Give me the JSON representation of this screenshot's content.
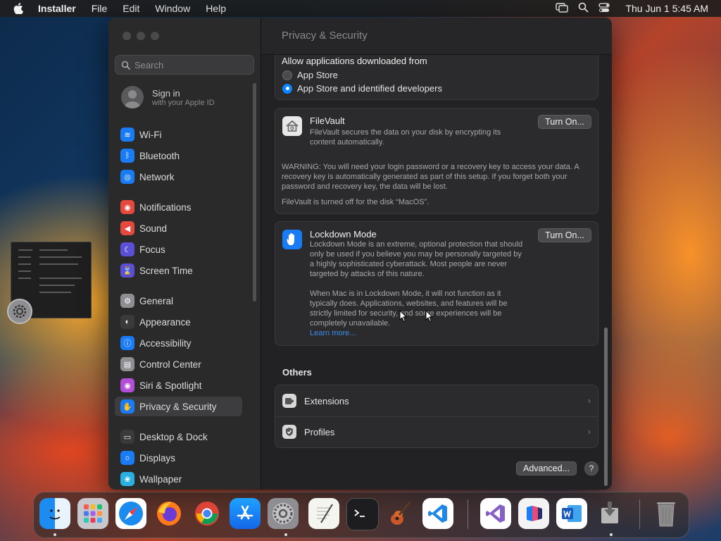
{
  "menubar": {
    "app_name": "Installer",
    "menus": [
      "File",
      "Edit",
      "Window",
      "Help"
    ],
    "clock": "Thu Jun 1  5:45 AM"
  },
  "sidebar": {
    "search_placeholder": "Search",
    "signin_title": "Sign in",
    "signin_subtitle": "with your Apple ID",
    "items": [
      {
        "label": "Wi-Fi",
        "icon": "wifi-icon",
        "color": "#1a7cf5"
      },
      {
        "label": "Bluetooth",
        "icon": "bluetooth-icon",
        "color": "#1a7cf5"
      },
      {
        "label": "Network",
        "icon": "network-icon",
        "color": "#1a7cf5"
      },
      {
        "label": "Notifications",
        "icon": "notifications-icon",
        "color": "#e5483c"
      },
      {
        "label": "Sound",
        "icon": "sound-icon",
        "color": "#e5483c"
      },
      {
        "label": "Focus",
        "icon": "focus-icon",
        "color": "#5b4fd6"
      },
      {
        "label": "Screen Time",
        "icon": "screen-time-icon",
        "color": "#5b4fd6"
      },
      {
        "label": "General",
        "icon": "general-icon",
        "color": "#8e8e93"
      },
      {
        "label": "Appearance",
        "icon": "appearance-icon",
        "color": "#3a3a3c"
      },
      {
        "label": "Accessibility",
        "icon": "accessibility-icon",
        "color": "#1a7cf5"
      },
      {
        "label": "Control Center",
        "icon": "control-center-icon",
        "color": "#8e8e93"
      },
      {
        "label": "Siri & Spotlight",
        "icon": "siri-icon",
        "color": "#b34fd6"
      },
      {
        "label": "Privacy & Security",
        "icon": "privacy-hand-icon",
        "color": "#1a7cf5"
      },
      {
        "label": "Desktop & Dock",
        "icon": "desktop-dock-icon",
        "color": "#3a3a3c"
      },
      {
        "label": "Displays",
        "icon": "displays-icon",
        "color": "#1a7cf5"
      },
      {
        "label": "Wallpaper",
        "icon": "wallpaper-icon",
        "color": "#2ab0e0"
      }
    ],
    "selected": "Privacy & Security"
  },
  "content": {
    "title": "Privacy & Security",
    "allow": {
      "heading": "Allow applications downloaded from",
      "options": [
        "App Store",
        "App Store and identified developers"
      ],
      "selected_index": 1
    },
    "filevault": {
      "title": "FileVault",
      "description": "FileVault secures the data on your disk by encrypting its content automatically.",
      "warning": "WARNING: You will need your login password or a recovery key to access your data. A recovery key is automatically generated as part of this setup. If you forget both your password and recovery key, the data will be lost.",
      "status": "FileVault is turned off for the disk “MacOS”.",
      "button": "Turn On..."
    },
    "lockdown": {
      "title": "Lockdown Mode",
      "description": "Lockdown Mode is an extreme, optional protection that should only be used if you believe you may be personally targeted by a highly sophisticated cyberattack. Most people are never targeted by attacks of this nature.",
      "description2": "When Mac is in Lockdown Mode, it will not function as it typically does. Applications, websites, and features will be strictly limited for security, and some experiences will be completely unavailable.",
      "learn_more": "Learn more...",
      "button": "Turn On..."
    },
    "others_heading": "Others",
    "others": [
      {
        "label": "Extensions",
        "icon": "extensions-icon"
      },
      {
        "label": "Profiles",
        "icon": "profiles-icon"
      }
    ],
    "advanced_button": "Advanced...",
    "help_button": "?"
  },
  "dock": {
    "apps": [
      "Finder",
      "Launchpad",
      "Safari",
      "Firefox",
      "Chrome",
      "App Store",
      "System Settings",
      "TextEdit",
      "Terminal",
      "GarageBand",
      "VS Code",
      "Visual Studio",
      "Testflight",
      "Word",
      "Installer",
      "Trash"
    ]
  }
}
